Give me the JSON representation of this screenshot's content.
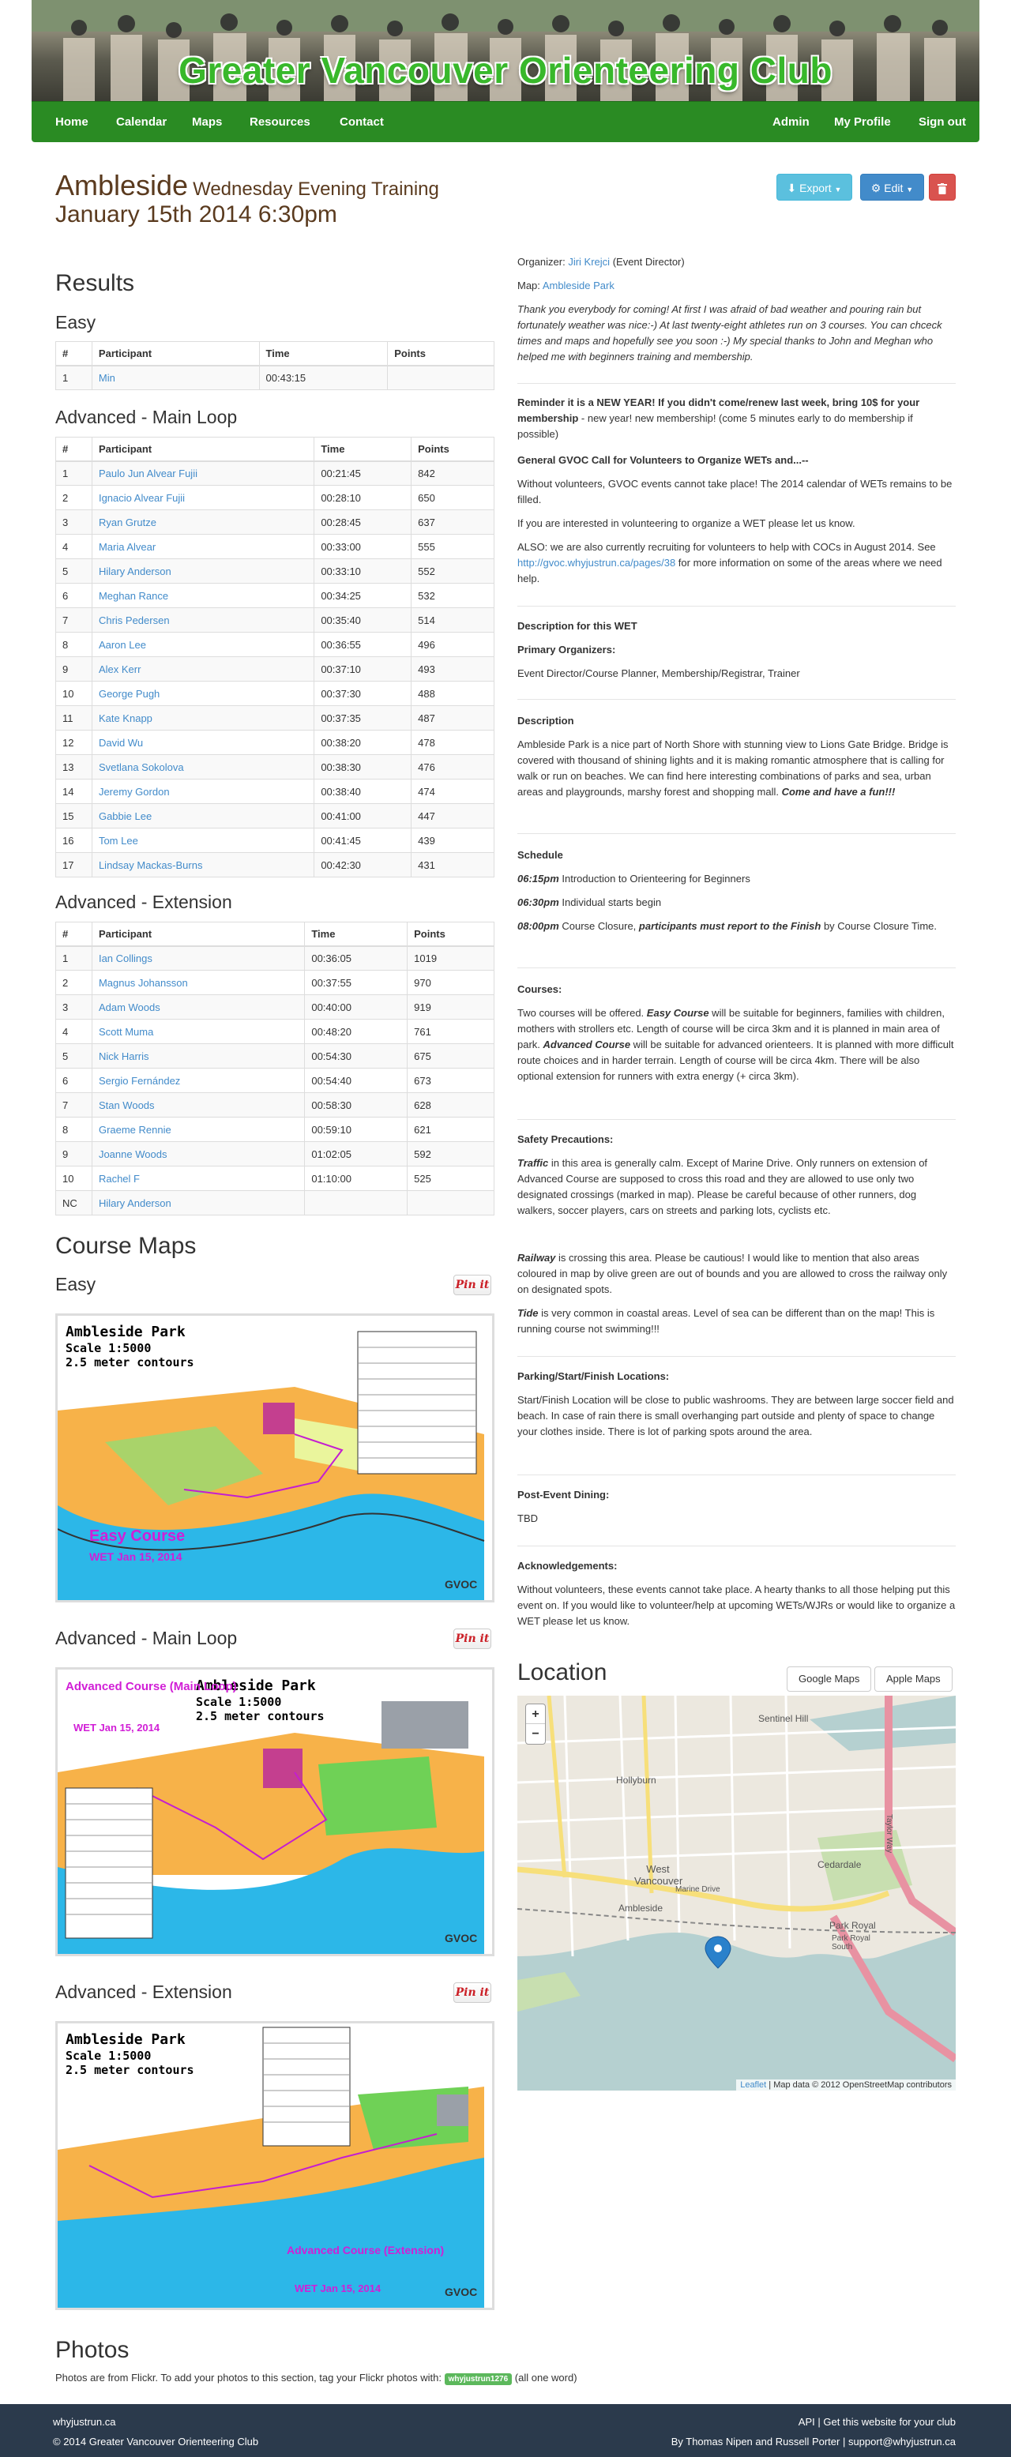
{
  "header": {
    "site_title": "Greater Vancouver Orienteering Club",
    "nav_left": [
      "Home",
      "Calendar",
      "Maps",
      "Resources",
      "Contact"
    ],
    "nav_right": [
      "Admin",
      "My Profile",
      "Sign out"
    ],
    "colors": {
      "nav": "#2a8b23",
      "title": "#38b82b"
    }
  },
  "event": {
    "name": "Ambleside",
    "type": "Wednesday Evening Training",
    "date": "January 15th 2014 6:30pm",
    "buttons": {
      "export": "Export",
      "edit": "Edit",
      "delete_icon": "trash-icon"
    }
  },
  "results": {
    "heading": "Results",
    "easy": {
      "title": "Easy",
      "columns": [
        "#",
        "Participant",
        "Time",
        "Points"
      ],
      "rows": [
        [
          "1",
          "Min",
          "00:43:15",
          ""
        ]
      ]
    },
    "main": {
      "title": "Advanced - Main Loop",
      "columns": [
        "#",
        "Participant",
        "Time",
        "Points"
      ],
      "rows": [
        [
          "1",
          "Paulo Jun Alvear Fujii",
          "00:21:45",
          "842"
        ],
        [
          "2",
          "Ignacio Alvear Fujii",
          "00:28:10",
          "650"
        ],
        [
          "3",
          "Ryan Grutze",
          "00:28:45",
          "637"
        ],
        [
          "4",
          "Maria Alvear",
          "00:33:00",
          "555"
        ],
        [
          "5",
          "Hilary Anderson",
          "00:33:10",
          "552"
        ],
        [
          "6",
          "Meghan Rance",
          "00:34:25",
          "532"
        ],
        [
          "7",
          "Chris Pedersen",
          "00:35:40",
          "514"
        ],
        [
          "8",
          "Aaron Lee",
          "00:36:55",
          "496"
        ],
        [
          "9",
          "Alex Kerr",
          "00:37:10",
          "493"
        ],
        [
          "10",
          "George Pugh",
          "00:37:30",
          "488"
        ],
        [
          "11",
          "Kate Knapp",
          "00:37:35",
          "487"
        ],
        [
          "12",
          "David Wu",
          "00:38:20",
          "478"
        ],
        [
          "13",
          "Svetlana Sokolova",
          "00:38:30",
          "476"
        ],
        [
          "14",
          "Jeremy Gordon",
          "00:38:40",
          "474"
        ],
        [
          "15",
          "Gabbie Lee",
          "00:41:00",
          "447"
        ],
        [
          "16",
          "Tom Lee",
          "00:41:45",
          "439"
        ],
        [
          "17",
          "Lindsay Mackas-Burns",
          "00:42:30",
          "431"
        ]
      ]
    },
    "extension": {
      "title": "Advanced - Extension",
      "columns": [
        "#",
        "Participant",
        "Time",
        "Points"
      ],
      "rows": [
        [
          "1",
          "Ian Collings",
          "00:36:05",
          "1019"
        ],
        [
          "2",
          "Magnus Johansson",
          "00:37:55",
          "970"
        ],
        [
          "3",
          "Adam Woods",
          "00:40:00",
          "919"
        ],
        [
          "4",
          "Scott Muma",
          "00:48:20",
          "761"
        ],
        [
          "5",
          "Nick Harris",
          "00:54:30",
          "675"
        ],
        [
          "6",
          "Sergio Fernández",
          "00:54:40",
          "673"
        ],
        [
          "7",
          "Stan Woods",
          "00:58:30",
          "628"
        ],
        [
          "8",
          "Graeme Rennie",
          "00:59:10",
          "621"
        ],
        [
          "9",
          "Joanne Woods",
          "01:02:05",
          "592"
        ],
        [
          "10",
          "Rachel F",
          "01:10:00",
          "525"
        ],
        [
          "NC",
          "Hilary Anderson",
          "",
          ""
        ]
      ]
    }
  },
  "course_maps": {
    "heading": "Course Maps",
    "pin_label": "Pin it",
    "maps": [
      {
        "title": "Easy",
        "map_title": "Ambleside Park",
        "scale": "Scale 1:5000",
        "contours": "2.5 meter contours",
        "course_label": "Easy Course",
        "date_label": "WET Jan 15, 2014",
        "logo": "GVOC"
      },
      {
        "title": "Advanced - Main Loop",
        "map_title": "Ambleside Park",
        "scale": "Scale 1:5000",
        "contours": "2.5 meter contours",
        "course_label": "Advanced Course (Main Loop)",
        "date_label": "WET Jan 15, 2014",
        "logo": "GVOC"
      },
      {
        "title": "Advanced - Extension",
        "map_title": "Ambleside Park",
        "scale": "Scale 1:5000",
        "contours": "2.5 meter contours",
        "course_label": "Advanced Course (Extension)",
        "date_label": "WET Jan 15, 2014",
        "logo": "GVOC"
      }
    ]
  },
  "photos": {
    "heading": "Photos",
    "text_before": "Photos are from Flickr. To add your photos to this section, tag your Flickr photos with:",
    "tag": "whyjustrun1276",
    "text_after": "(all one word)"
  },
  "details": {
    "organizer_label": "Organizer:",
    "organizer_name": "Jiri Krejci",
    "organizer_role": "(Event Director)",
    "map_label": "Map:",
    "map_name": "Ambleside Park",
    "intro": "Thank you everybody for coming! At first I was afraid of bad weather and pouring rain but fortunately weather was nice:-) At last twenty-eight athletes run on 3 courses. You can chceck times and maps and hopefully see you soon :-) My special thanks to John and Meghan who helped me with beginners training and membership.",
    "reminder_bold": "Reminder it is a NEW YEAR! If you didn't come/renew last week, bring 10$ for your membership",
    "reminder_rest": " - new year! new membership! (come 5 minutes early to do membership if possible)",
    "call_title": "General GVOC Call for Volunteers to Organize WETs and...--",
    "call_p1": "Without volunteers, GVOC events cannot take place! The 2014 calendar of WETs remains to be filled.",
    "call_p2": "If you are interested in volunteering to organize a WET please let us know.",
    "call_p3_a": "ALSO: we are also currently recruiting for volunteers to help with COCs in August 2014. See ",
    "call_p3_link": "http://gvoc.whyjustrun.ca/pages/38",
    "call_p3_b": " for more information on some of the areas where we need help.",
    "desc_title": "Description for this WET",
    "primary_title": "Primary Organizers:",
    "primary_list": "Event Director/Course Planner, Membership/Registrar, Trainer",
    "description_title": "Description",
    "description_text": "Ambleside Park is a nice part of North Shore with stunning view to Lions Gate Bridge. Bridge is covered with thousand of shining lights and it is making romantic atmosphere that is calling for walk or run on beaches. We can find here interesting combinations of parks and sea, urban areas and playgrounds, marshy forest and shopping mall. ",
    "description_end": "Come and have a fun!!!",
    "schedule_title": "Schedule",
    "schedule": [
      {
        "time": "06:15pm",
        "text": " Introduction to Orienteering for Beginners"
      },
      {
        "time": "06:30pm",
        "text": " Individual starts begin"
      },
      {
        "time": "08:00pm",
        "text_a": " Course Closure, ",
        "text_bold": "participants must report to the Finish",
        "text_b": " by Course Closure Time."
      }
    ],
    "courses_title": "Courses:",
    "courses_a": "Two courses will be offered. ",
    "courses_easy": "Easy Course",
    "courses_b": " will be suitable for beginners, families with children, mothers with strollers etc. Length of course will be circa 3km and it is planned in main area of park. ",
    "courses_adv": "Advanced Course",
    "courses_c": " will be suitable for advanced orienteers. It is planned with more difficult route choices and in harder terrain. Length of course will be circa 4km. There will be also optional extension for runners with extra energy (+ circa 3km).",
    "safety_title": "Safety Precautions:",
    "safety_traffic": "Traffic",
    "safety_traffic_text": " in this area is generally calm. Except of Marine Drive. Only runners on extension of Advanced Course are supposed to cross this road and they are allowed to use only two designated crossings (marked in map). Please be careful because of other runners, dog walkers, soccer players, cars on streets and parking lots, cyclists etc.",
    "safety_railway": "Railway",
    "safety_railway_text": " is crossing this area. Please be cautious! I would like to mention that also areas coloured in map by olive green are out of bounds and you are allowed to cross the railway only on designated spots.",
    "safety_tide": "Tide",
    "safety_tide_text": " is very common in coastal areas. Level of sea can be different than on the map! This is running course not swimming!!!",
    "parking_title": "Parking/Start/Finish Locations:",
    "parking_text": "Start/Finish Location will be close to public washrooms. They are between large soccer field and beach. In case of rain there is small overhanging part outside and plenty of space to change your clothes inside. There is lot of parking spots around the area.",
    "dining_title": "Post-Event Dining:",
    "dining_text": "TBD",
    "ack_title": "Acknowledgements:",
    "ack_text": "Without volunteers, these events cannot take place. A hearty thanks to all those helping put this event on. If you would like to volunteer/help at upcoming WETs/WJRs or would like to organize a WET please let us know."
  },
  "location": {
    "heading": "Location",
    "google": "Google Maps",
    "apple": "Apple Maps",
    "zoom_in": "+",
    "zoom_out": "−",
    "labels": [
      "Sentinel Hill",
      "Hollyburn",
      "West Vancouver",
      "Cedardale",
      "Ambleside",
      "Park Royal",
      "Park Royal South",
      "Marine Drive",
      "Taylor Way"
    ],
    "attribution_link": "Leaflet",
    "attribution_text": " | Map data © 2012 OpenStreetMap contributors"
  },
  "footer": {
    "left_top": "whyjustrun.ca",
    "left_bottom": "© 2014 Greater Vancouver Orienteering Club",
    "right_top_a": "API",
    "right_top_b": "Get this website for your club",
    "right_bottom_a": "By Thomas Nipen and Russell Porter",
    "right_bottom_b": "support@whyjustrun.ca"
  }
}
